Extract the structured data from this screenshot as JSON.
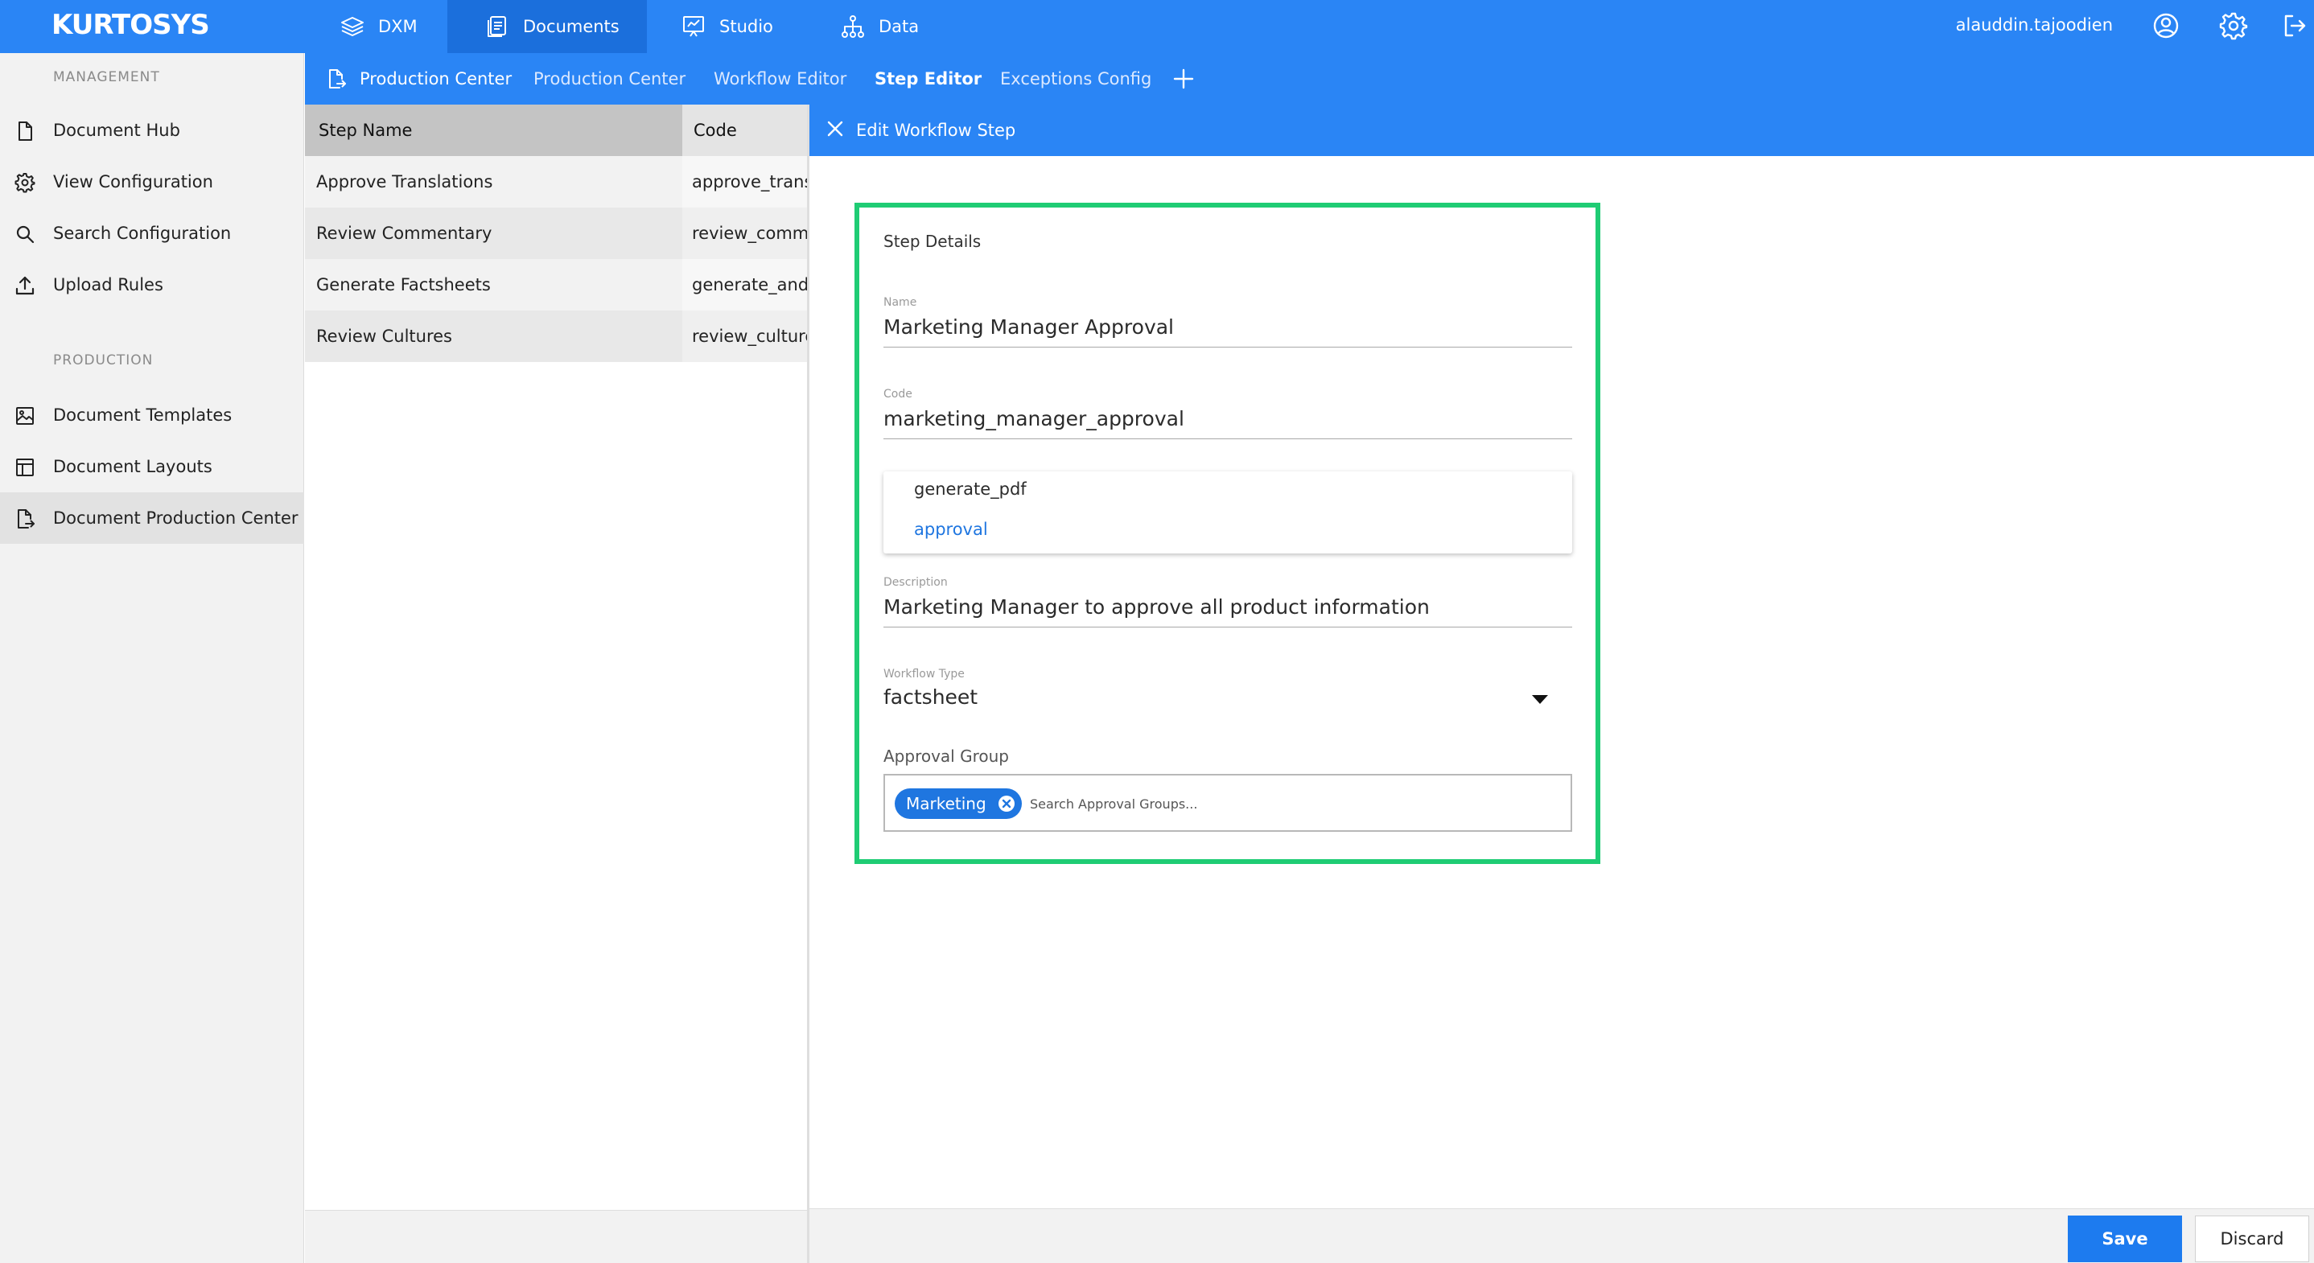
{
  "app": {
    "logo": "KURTOSYS"
  },
  "topnav": {
    "items": [
      {
        "label": "DXM",
        "icon": "layers-icon"
      },
      {
        "label": "Documents",
        "icon": "document-icon",
        "active": true
      },
      {
        "label": "Studio",
        "icon": "presentation-icon"
      },
      {
        "label": "Data",
        "icon": "hierarchy-icon"
      }
    ],
    "user": "alauddin.tajoodien",
    "icons": [
      "user-circle-icon",
      "gear-icon",
      "logout-icon"
    ]
  },
  "sidebar": {
    "sections": [
      {
        "title": "MANAGEMENT",
        "items": [
          {
            "label": "Document Hub",
            "icon": "file-icon"
          },
          {
            "label": "View Configuration",
            "icon": "gear-icon"
          },
          {
            "label": "Search Configuration",
            "icon": "search-icon"
          },
          {
            "label": "Upload Rules",
            "icon": "upload-icon"
          }
        ]
      },
      {
        "title": "PRODUCTION",
        "items": [
          {
            "label": "Document Templates",
            "icon": "image-icon"
          },
          {
            "label": "Document Layouts",
            "icon": "layout-icon"
          },
          {
            "label": "Document Production Center",
            "icon": "file-export-icon",
            "active": true
          }
        ]
      }
    ]
  },
  "subtabs": {
    "items": [
      {
        "label": "Production Center"
      },
      {
        "label": "Production Center"
      },
      {
        "label": "Workflow Editor"
      },
      {
        "label": "Step Editor",
        "active": true
      },
      {
        "label": "Exceptions Config"
      }
    ],
    "add_icon": "plus-icon"
  },
  "table": {
    "columns": [
      "Step Name",
      "Code"
    ],
    "rows": [
      {
        "name": "Approve Translations",
        "code": "approve_trans"
      },
      {
        "name": "Review Commentary",
        "code": "review_comme"
      },
      {
        "name": "Generate Factsheets",
        "code": "generate_and_"
      },
      {
        "name": "Review Cultures",
        "code": "review_culture"
      }
    ]
  },
  "panel": {
    "title": "Edit Workflow Step",
    "section_title": "Step Details",
    "name": {
      "label": "Name",
      "value": "Marketing Manager Approval"
    },
    "code": {
      "label": "Code",
      "value": "marketing_manager_approval"
    },
    "dropdown_options": [
      {
        "label": "generate_pdf"
      },
      {
        "label": "approval",
        "highlighted": true
      }
    ],
    "description": {
      "label": "Description",
      "value": "Marketing Manager to approve all product information"
    },
    "workflow_type": {
      "label": "Workflow Type",
      "value": "factsheet"
    },
    "approval_group": {
      "label": "Approval Group",
      "chips": [
        "Marketing"
      ],
      "placeholder": "Search Approval Groups..."
    }
  },
  "footer": {
    "save": "Save",
    "discard": "Discard"
  },
  "colors": {
    "brand": "#2a85f5",
    "brand_dark": "#1b6fdc",
    "highlight_box": "#1fcc74",
    "chip": "#1f76e0",
    "link": "#1f76e0"
  }
}
